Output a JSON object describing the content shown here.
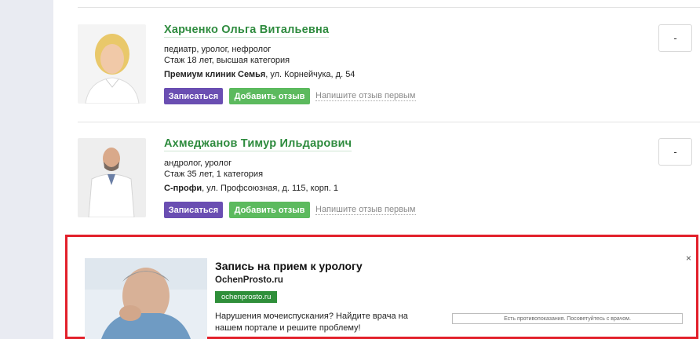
{
  "doctors": [
    {
      "name": "Харченко Ольга Витальевна",
      "specialties": "педиатр, уролог, нефролог",
      "experience": "Стаж 18 лет, высшая категория",
      "clinic": "Премиум клиник Семья",
      "address": ", ул. Корнейчука, д. 54",
      "book_label": "Записаться",
      "review_label": "Добавить отзыв",
      "first_review_label": "Напишите отзыв первым",
      "side_button": "-"
    },
    {
      "name": "Ахмеджанов Тимур Ильдарович",
      "specialties": "андролог, уролог",
      "experience": "Стаж 35 лет, 1 категория",
      "clinic": "С-профи",
      "address": ", ул. Профсоюзная, д. 115, корп. 1",
      "book_label": "Записаться",
      "review_label": "Добавить отзыв",
      "first_review_label": "Напишите отзыв первым",
      "side_button": "-"
    }
  ],
  "ad": {
    "title": "Запись на прием к урологу",
    "domain": "OchenProsto.ru",
    "badge": "ochenprosto.ru",
    "text": "Нарушения мочеиспускания? Найдите врача на нашем портале и решите проблему!",
    "warning": "Есть противопоказания. Посоветуйтесь с врачом.",
    "close": "×"
  },
  "colors": {
    "name_green": "#2e8b3e",
    "book_purple": "#6a4eb2",
    "review_green": "#5cba5e",
    "ad_border_red": "#e2202b"
  }
}
